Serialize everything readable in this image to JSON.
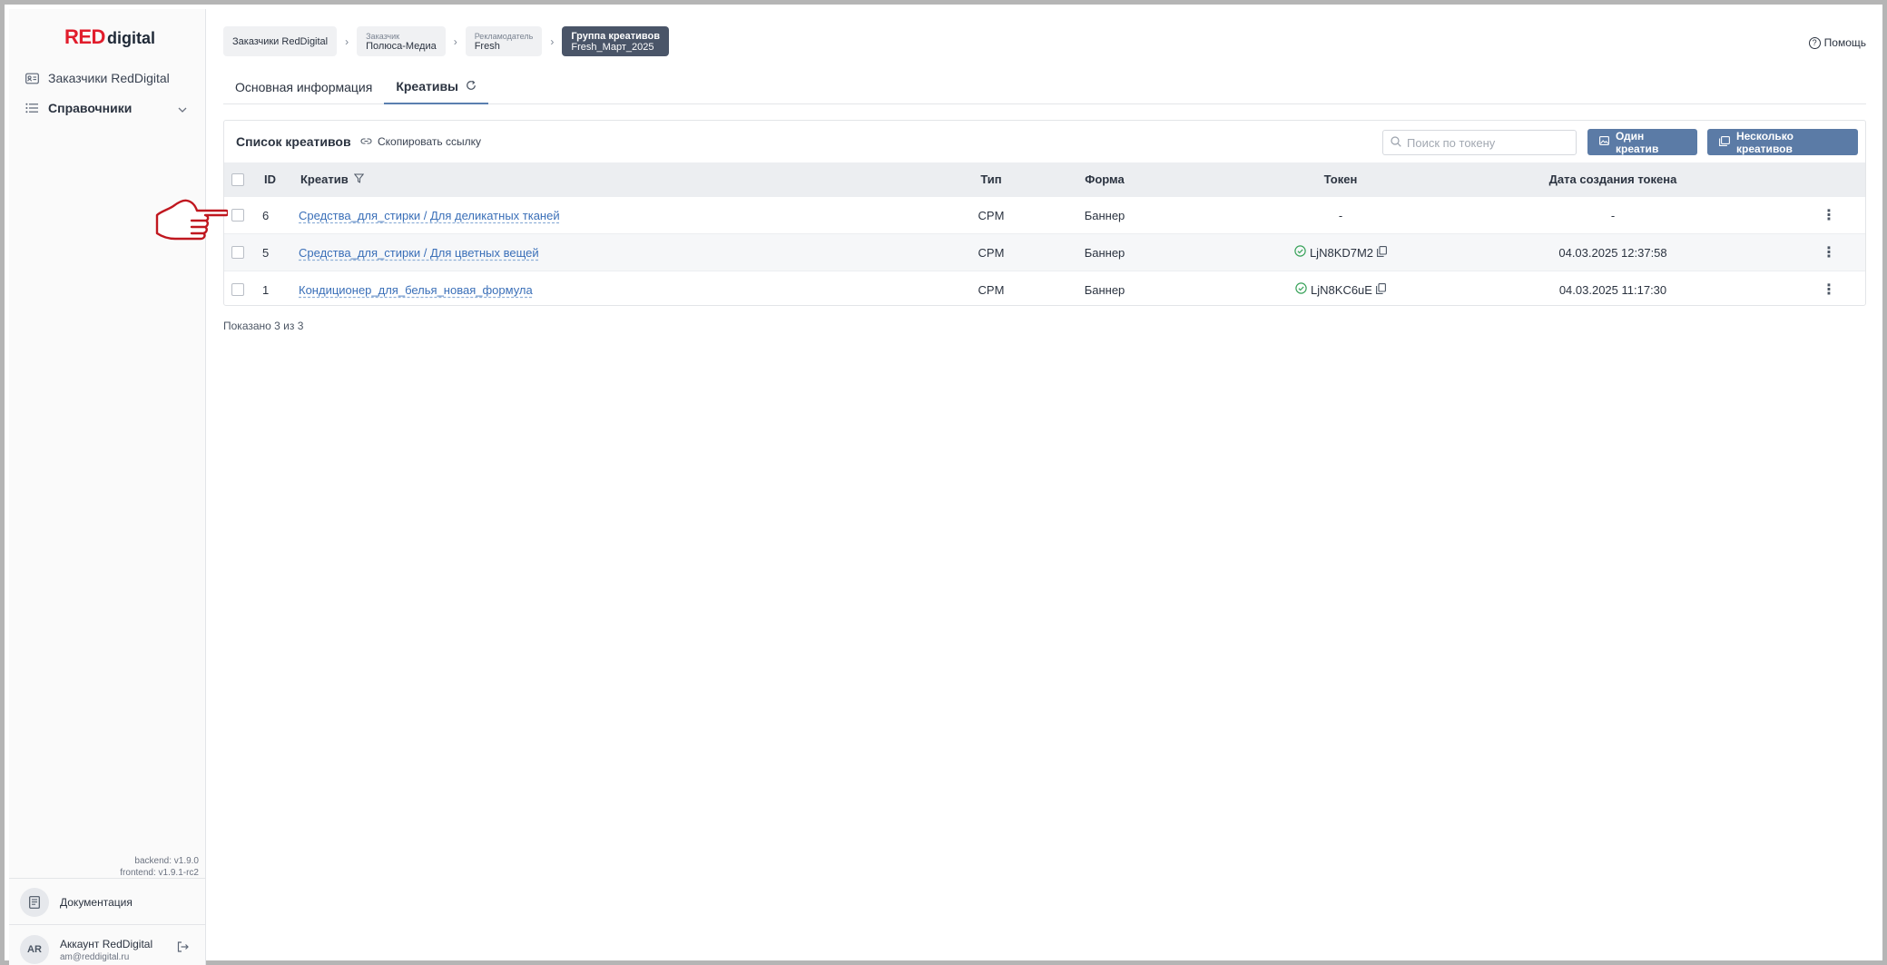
{
  "sidebar": {
    "logo_red": "RED",
    "logo_digital": "digital",
    "items": [
      {
        "label": "Заказчики RedDigital",
        "icon": "id-card-icon"
      },
      {
        "label": "Справочники",
        "icon": "list-icon"
      }
    ],
    "versions": {
      "backend": "backend: v1.9.0",
      "frontend": "frontend: v1.9.1-rc2"
    },
    "docs_label": "Документация",
    "account": {
      "initials": "AR",
      "name": "Аккаунт RedDigital",
      "email": "am@reddigital.ru"
    }
  },
  "breadcrumbs": [
    {
      "small": "",
      "label": "Заказчики RedDigital"
    },
    {
      "small": "Заказчик",
      "label": "Полюса-Медиа"
    },
    {
      "small": "Рекламодатель",
      "label": "Fresh"
    },
    {
      "small": "Группа креативов",
      "label": "Fresh_Март_2025"
    }
  ],
  "help_label": "Помощь",
  "tabs": [
    {
      "label": "Основная информация"
    },
    {
      "label": "Креативы"
    }
  ],
  "card": {
    "title": "Список креативов",
    "copy_link": "Скопировать ссылку",
    "search_placeholder": "Поиск по токену",
    "btn_one": "Один креатив",
    "btn_many": "Несколько креативов"
  },
  "table": {
    "headers": {
      "id": "ID",
      "creative": "Креатив",
      "type": "Тип",
      "form": "Форма",
      "token": "Токен",
      "date": "Дата создания токена"
    },
    "rows": [
      {
        "id": "6",
        "creative": "Средства_для_стирки / Для деликатных тканей",
        "type": "CPM",
        "form": "Баннер",
        "token": "-",
        "date": "-"
      },
      {
        "id": "5",
        "creative": "Средства_для_стирки / Для цветных вещей",
        "type": "CPM",
        "form": "Баннер",
        "token": "LjN8KD7M2",
        "date": "04.03.2025 12:37:58"
      },
      {
        "id": "1",
        "creative": "Кондиционер_для_белья_новая_формула",
        "type": "CPM",
        "form": "Баннер",
        "token": "LjN8KC6uE",
        "date": "04.03.2025 11:17:30"
      }
    ]
  },
  "shown_text": "Показано 3 из 3",
  "colors": {
    "brand_red": "#e11d2c",
    "accent": "#5b7ba6",
    "link": "#3a6fb8",
    "ok": "#3aa35b"
  }
}
